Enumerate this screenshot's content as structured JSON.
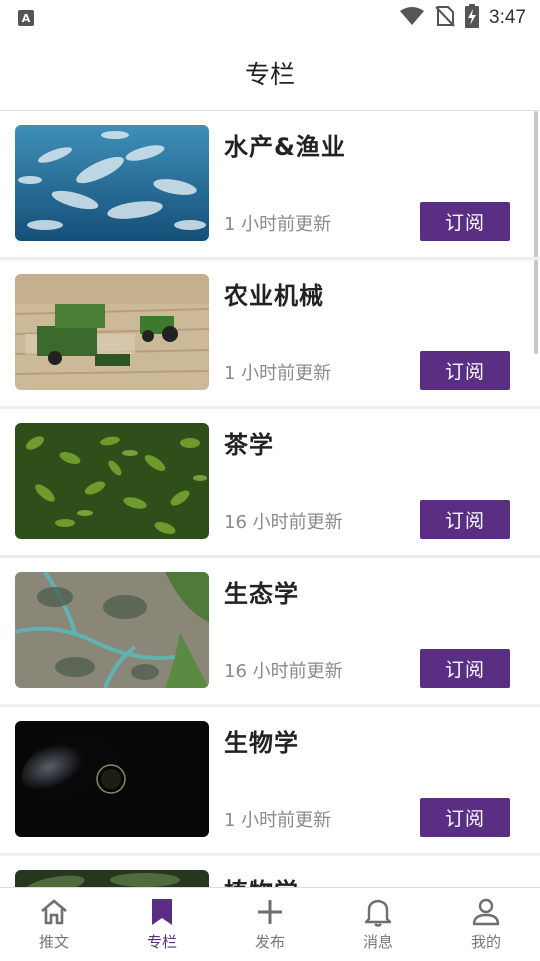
{
  "status_bar": {
    "time": "3:47",
    "notification_icon_letter": "A"
  },
  "header": {
    "title": "专栏"
  },
  "colors": {
    "accent": "#5a2e82",
    "inactive": "#6e6e6e"
  },
  "columns": [
    {
      "title": "水产&渔业",
      "updated": "1 小时前更新",
      "button": "订阅",
      "image": "fish-school"
    },
    {
      "title": "农业机械",
      "updated": "1 小时前更新",
      "button": "订阅",
      "image": "harvester-field"
    },
    {
      "title": "茶学",
      "updated": "16 小时前更新",
      "button": "订阅",
      "image": "tea-leaves"
    },
    {
      "title": "生态学",
      "updated": "16 小时前更新",
      "button": "订阅",
      "image": "wetland-aerial"
    },
    {
      "title": "生物学",
      "updated": "1 小时前更新",
      "button": "订阅",
      "image": "microscope-dark"
    },
    {
      "title": "植物学",
      "updated": "",
      "button": "",
      "image": "plant-leaves"
    }
  ],
  "tabs": [
    {
      "label": "推文",
      "icon": "home-icon",
      "active": false
    },
    {
      "label": "专栏",
      "icon": "bookmark-icon",
      "active": true
    },
    {
      "label": "发布",
      "icon": "plus-icon",
      "active": false
    },
    {
      "label": "消息",
      "icon": "bell-icon",
      "active": false
    },
    {
      "label": "我的",
      "icon": "person-icon",
      "active": false
    }
  ]
}
